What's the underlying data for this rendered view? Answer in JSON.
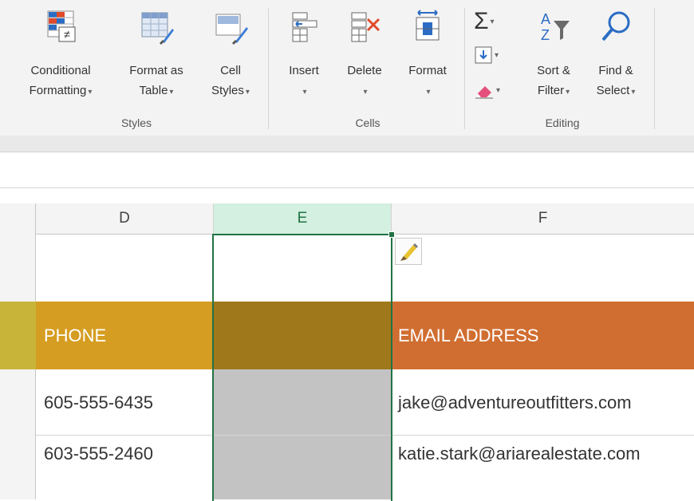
{
  "ribbon": {
    "styles": {
      "conditional_line1": "Conditional",
      "conditional_line2": "Formatting",
      "format_table_line1": "Format as",
      "format_table_line2": "Table",
      "cell_styles_line1": "Cell",
      "cell_styles_line2": "Styles",
      "group_label": "Styles"
    },
    "cells": {
      "insert": "Insert",
      "delete": "Delete",
      "format": "Format",
      "group_label": "Cells"
    },
    "editing": {
      "sort_line1": "Sort &",
      "sort_line2": "Filter",
      "find_line1": "Find &",
      "find_line2": "Select",
      "group_label": "Editing"
    },
    "dropdown_caret": "▾"
  },
  "columns": {
    "d": "D",
    "e": "E",
    "f": "F"
  },
  "sheet": {
    "header_phone": "PHONE",
    "header_email": "EMAIL ADDRESS",
    "rows": [
      {
        "phone": "605-555-6435",
        "email": "jake@adventureoutfitters.com"
      },
      {
        "phone": "603-555-2460",
        "email": "katie.stark@ariarealestate.com"
      }
    ]
  },
  "colors": {
    "phone_header": "#d59d21",
    "selected_header": "#a0781c",
    "email_header": "#d06e31",
    "selected_col_cells": "#c3c3c3",
    "selection_border": "#217346"
  }
}
